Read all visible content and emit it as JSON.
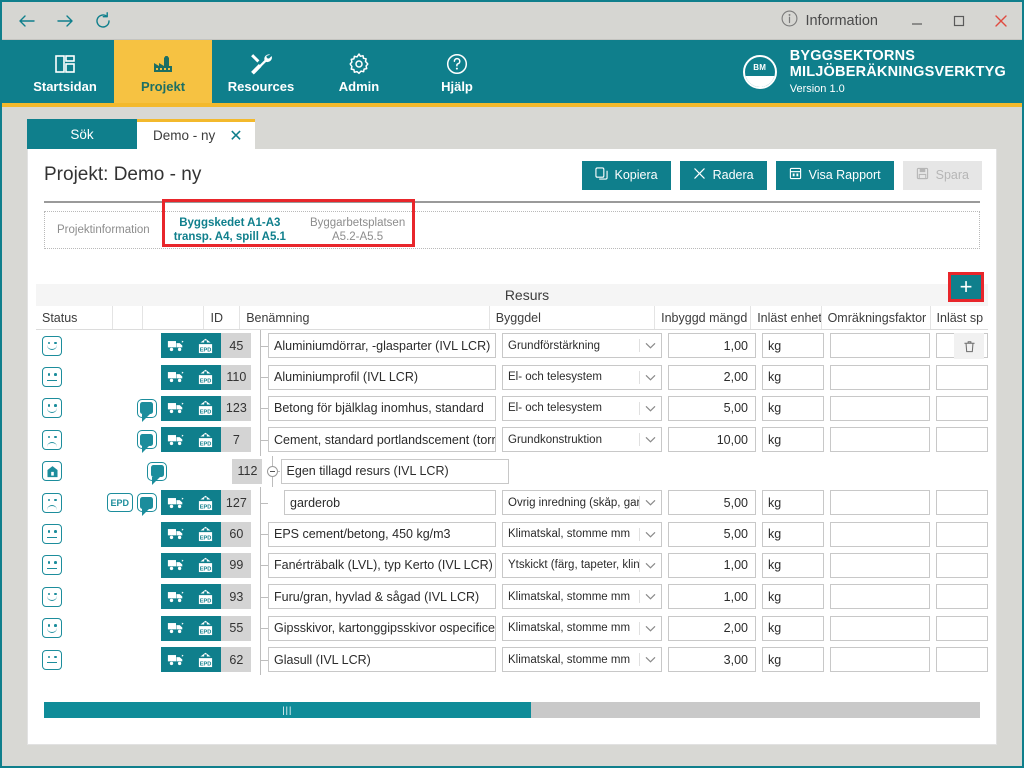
{
  "titlebar": {
    "back_icon": "arrow-left-icon",
    "forward_icon": "arrow-right-icon",
    "refresh_icon": "refresh-icon",
    "info_label": "Information",
    "info_icon": "info-circle-icon",
    "minimize_label": "—",
    "maximize_label": "☐",
    "close_label": "✕"
  },
  "nav": {
    "items": [
      {
        "label": "Startsidan",
        "icon": "home-dashboard-icon",
        "active": false
      },
      {
        "label": "Projekt",
        "icon": "factory-icon",
        "active": true
      },
      {
        "label": "Resources",
        "icon": "tools-icon",
        "active": false
      },
      {
        "label": "Admin",
        "icon": "gear-icon",
        "active": false
      },
      {
        "label": "Hjälp",
        "icon": "question-circle-icon",
        "active": false
      }
    ]
  },
  "brand": {
    "logo_text": "BM",
    "line1": "BYGGSEKTORNS",
    "line2": "MILJÖBERÄKNINGSVERKTYG",
    "version": "Version 1.0"
  },
  "window_tabs": {
    "search_tab": "Sök",
    "open_tab": "Demo - ny",
    "close_icon": "✕"
  },
  "page": {
    "title": "Projekt: Demo - ny",
    "buttons": [
      {
        "label": "Kopiera",
        "icon": "copy-icon",
        "disabled": false
      },
      {
        "label": "Radera",
        "icon": "x-icon",
        "disabled": false
      },
      {
        "label": "Visa Rapport",
        "icon": "report-icon",
        "disabled": false
      },
      {
        "label": "Spara",
        "icon": "save-icon",
        "disabled": true
      }
    ]
  },
  "section_tabs": [
    {
      "label_line1": "Projektinformation",
      "label_line2": "",
      "active": false
    },
    {
      "label_line1": "Byggskedet A1-A3",
      "label_line2": "transp. A4, spill A5.1",
      "active": true
    },
    {
      "label_line1": "Byggarbetsplatsen",
      "label_line2": "A5.2-A5.5",
      "active": false
    }
  ],
  "grid": {
    "group_header": "Resurs",
    "add_button_label": "+",
    "delete_button_icon": "trash-icon",
    "columns": [
      "Status",
      "",
      "",
      "",
      "ID",
      "Benämning",
      "Byggdel",
      "Inbyggd mängd",
      "Inläst enhet",
      "Omräkningsfaktor",
      "Inläst sp"
    ],
    "rows": [
      {
        "status": "happy",
        "has_epd_badge": false,
        "has_comment": false,
        "has_action_buttons": true,
        "id": "45",
        "benamning": "Aluminiumdörrar, -glasparter (IVL LCR)",
        "byggdel": "Grundförstärkning",
        "mangd": "1,00",
        "enhet": "kg",
        "omrakningsfaktor": "",
        "spill": "",
        "is_child": false,
        "is_parent": false
      },
      {
        "status": "neutral",
        "has_epd_badge": false,
        "has_comment": false,
        "has_action_buttons": true,
        "id": "110",
        "benamning": "Aluminiumprofil (IVL LCR)",
        "byggdel": "El- och telesystem",
        "mangd": "2,00",
        "enhet": "kg",
        "omrakningsfaktor": "",
        "spill": "",
        "is_child": false,
        "is_parent": false
      },
      {
        "status": "happy",
        "has_epd_badge": false,
        "has_comment": true,
        "has_action_buttons": true,
        "id": "123",
        "benamning": "Betong för bjälklag inomhus, standard",
        "byggdel": "El- och telesystem",
        "mangd": "5,00",
        "enhet": "kg",
        "omrakningsfaktor": "",
        "spill": "",
        "is_child": false,
        "is_parent": false
      },
      {
        "status": "sad",
        "has_epd_badge": false,
        "has_comment": true,
        "has_action_buttons": true,
        "id": "7",
        "benamning": "Cement, standard portlandscement (torrbruk)",
        "byggdel": "Grundkonstruktion",
        "mangd": "10,00",
        "enhet": "kg",
        "omrakningsfaktor": "",
        "spill": "",
        "is_child": false,
        "is_parent": false
      },
      {
        "status": "house",
        "has_epd_badge": false,
        "has_comment": true,
        "has_action_buttons": false,
        "id": "112",
        "benamning": "Egen tillagd resurs (IVL LCR)",
        "byggdel": "",
        "mangd": "",
        "enhet": "",
        "omrakningsfaktor": "",
        "spill": "",
        "is_child": false,
        "is_parent": true
      },
      {
        "status": "sad",
        "has_epd_badge": true,
        "has_comment": true,
        "has_action_buttons": true,
        "id": "127",
        "benamning": "garderob",
        "byggdel": "Övrig inredning (skåp, garderob",
        "mangd": "5,00",
        "enhet": "kg",
        "omrakningsfaktor": "",
        "spill": "",
        "is_child": true,
        "is_parent": false
      },
      {
        "status": "neutral",
        "has_epd_badge": false,
        "has_comment": false,
        "has_action_buttons": true,
        "id": "60",
        "benamning": "EPS cement/betong, 450 kg/m3",
        "byggdel": "Klimatskal, stomme mm",
        "mangd": "5,00",
        "enhet": "kg",
        "omrakningsfaktor": "",
        "spill": "",
        "is_child": false,
        "is_parent": false
      },
      {
        "status": "neutral",
        "has_epd_badge": false,
        "has_comment": false,
        "has_action_buttons": true,
        "id": "99",
        "benamning": "Fanérträbalk (LVL), typ Kerto (IVL LCR)",
        "byggdel": "Ytskickt (färg, tapeter, klinker os",
        "mangd": "1,00",
        "enhet": "kg",
        "omrakningsfaktor": "",
        "spill": "",
        "is_child": false,
        "is_parent": false
      },
      {
        "status": "happy",
        "has_epd_badge": false,
        "has_comment": false,
        "has_action_buttons": true,
        "id": "93",
        "benamning": "Furu/gran, hyvlad & sågad  (IVL LCR)",
        "byggdel": "Klimatskal, stomme mm",
        "mangd": "1,00",
        "enhet": "kg",
        "omrakningsfaktor": "",
        "spill": "",
        "is_child": false,
        "is_parent": false
      },
      {
        "status": "happy",
        "has_epd_badge": false,
        "has_comment": false,
        "has_action_buttons": true,
        "id": "55",
        "benamning": "Gipsskivor, kartonggipsskivor ospecificerat",
        "byggdel": "Klimatskal, stomme mm",
        "mangd": "2,00",
        "enhet": "kg",
        "omrakningsfaktor": "",
        "spill": "",
        "is_child": false,
        "is_parent": false
      },
      {
        "status": "neutral",
        "has_epd_badge": false,
        "has_comment": false,
        "has_action_buttons": true,
        "id": "62",
        "benamning": "Glasull (IVL LCR)",
        "byggdel": "Klimatskal, stomme mm",
        "mangd": "3,00",
        "enhet": "kg",
        "omrakningsfaktor": "",
        "spill": "",
        "is_child": false,
        "is_parent": false
      }
    ]
  },
  "scrollbar": {
    "thumb_percent": 52,
    "grip": "|||"
  },
  "colors": {
    "teal": "#0f7f8c",
    "yellow": "#f6c242",
    "accent_underline": "#f3b92c",
    "highlight_red": "#e8262b",
    "icon_teal": "#1c8d9c"
  }
}
